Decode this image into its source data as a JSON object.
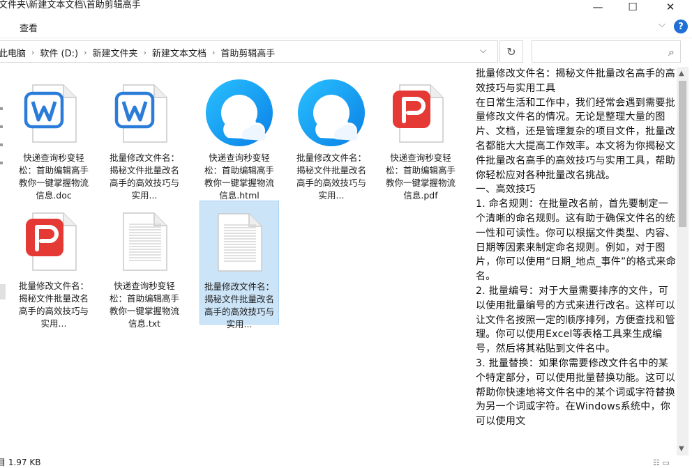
{
  "window": {
    "title": "文件夹\\新建文本文档\\首助剪辑高手",
    "minimize": "—",
    "maximize": "☐",
    "close": "✕"
  },
  "ribbon": {
    "tab_view": "查看",
    "help": "?",
    "expand_icon": "chevron-down-icon"
  },
  "address": {
    "crumbs": [
      "此电脑",
      "软件 (D:)",
      "新建文件夹",
      "新建文本文档",
      "首助剪辑高手"
    ],
    "dropdown_glyph": "⌵",
    "refresh_glyph": "↻"
  },
  "search": {
    "placeholder": "",
    "icon_glyph": "⌕"
  },
  "files": [
    {
      "type": "wps-writer",
      "name": "快递查询秒变轻松：首助编辑高手教你一键掌握物流信息.doc"
    },
    {
      "type": "wps-writer",
      "name": "批量修改文件名：揭秘文件批量改名高手的高效技巧与实用..."
    },
    {
      "type": "browser",
      "name": "快递查询秒变轻松：首助编辑高手教你一键掌握物流信息.html"
    },
    {
      "type": "browser",
      "name": "批量修改文件名：揭秘文件批量改名高手的高效技巧与实用..."
    },
    {
      "type": "wps-pdf",
      "name": "快递查询秒变轻松：首助编辑高手教你一键掌握物流信息.pdf"
    },
    {
      "type": "wps-pdf",
      "name": "批量修改文件名：揭秘文件批量改名高手的高效技巧与实用..."
    },
    {
      "type": "text",
      "name": "快递查询秒变轻松：首助编辑高手教你一键掌握物流信息.txt"
    },
    {
      "type": "text",
      "name": "批量修改文件名：揭秘文件批量改名高手的高效技巧与实用...",
      "selected": true
    }
  ],
  "preview": {
    "text": "批量修改文件名：揭秘文件批量改名高手的高效技巧与实用工具\n在日常生活和工作中，我们经常会遇到需要批量修改文件名的情况。无论是整理大量的图片、文档，还是管理复杂的项目文件，批量改名都能大大提高工作效率。本文将为你揭秘文件批量改名高手的高效技巧与实用工具，帮助你轻松应对各种批量改名挑战。\n一、高效技巧\n1. 命名规则：在批量改名前，首先要制定一个清晰的命名规则。这有助于确保文件名的统一性和可读性。你可以根据文件类型、内容、日期等因素来制定命名规则。例如，对于图片，你可以使用“日期_地点_事件”的格式来命名。\n2. 批量编号：对于大量需要排序的文件，可以使用批量编号的方式来进行改名。这样可以让文件名按照一定的顺序排列，方便查找和管理。你可以使用Excel等表格工具来生成编号，然后将其粘贴到文件名中。\n3. 批量替换：如果你需要修改文件名中的某个特定部分，可以使用批量替换功能。这可以帮助你快速地将文件名中的某个词或字符替换为另一个词或字符。在Windows系统中，你可以使用文"
  },
  "status": {
    "text": "目 1.97 KB"
  },
  "colors": {
    "accent": "#1f6fd6",
    "selection": "#cce4f7",
    "wps_writer": "#2b7cd8",
    "wps_pdf": "#e53935",
    "browser": "#1ea0f5"
  }
}
